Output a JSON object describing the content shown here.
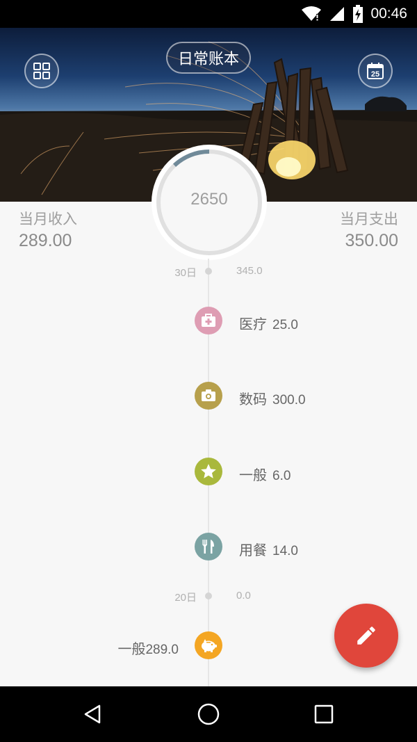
{
  "status_bar": {
    "time": "00:46",
    "icons": [
      "wifi-icon",
      "signal-icon",
      "battery-charging-icon"
    ]
  },
  "header": {
    "book_name": "日常账本",
    "left_icon": "grid-menu-icon",
    "right_icon": "calendar-icon",
    "calendar_day": "25"
  },
  "summary": {
    "income_label": "当月收入",
    "income_value": "289.00",
    "expense_label": "当月支出",
    "expense_value": "350.00",
    "budget_value": "2650",
    "budget_progress": 0.12
  },
  "timeline": {
    "groups": [
      {
        "day": "30日",
        "total": "345.0",
        "entries": [
          {
            "category": "医疗",
            "amount": "25.0",
            "type": "expense",
            "icon": "medical-kit-icon",
            "color": "#de9db3"
          },
          {
            "category": "数码",
            "amount": "300.0",
            "type": "expense",
            "icon": "camera-icon",
            "color": "#b7a04c"
          },
          {
            "category": "一般",
            "amount": "6.0",
            "type": "expense",
            "icon": "star-icon",
            "color": "#a9b83c"
          },
          {
            "category": "用餐",
            "amount": "14.0",
            "type": "expense",
            "icon": "fork-knife-icon",
            "color": "#7ba3a3"
          }
        ]
      },
      {
        "day": "20日",
        "total": "0.0",
        "entries": [
          {
            "category": "一般",
            "amount": "289.0",
            "type": "income",
            "icon": "piggy-bank-icon",
            "color": "#f4a623"
          }
        ]
      }
    ]
  },
  "fab": {
    "icon": "pencil-icon",
    "color": "#e0463b"
  },
  "nav_bar": {
    "buttons": [
      "back-icon",
      "home-icon",
      "recents-icon"
    ]
  }
}
